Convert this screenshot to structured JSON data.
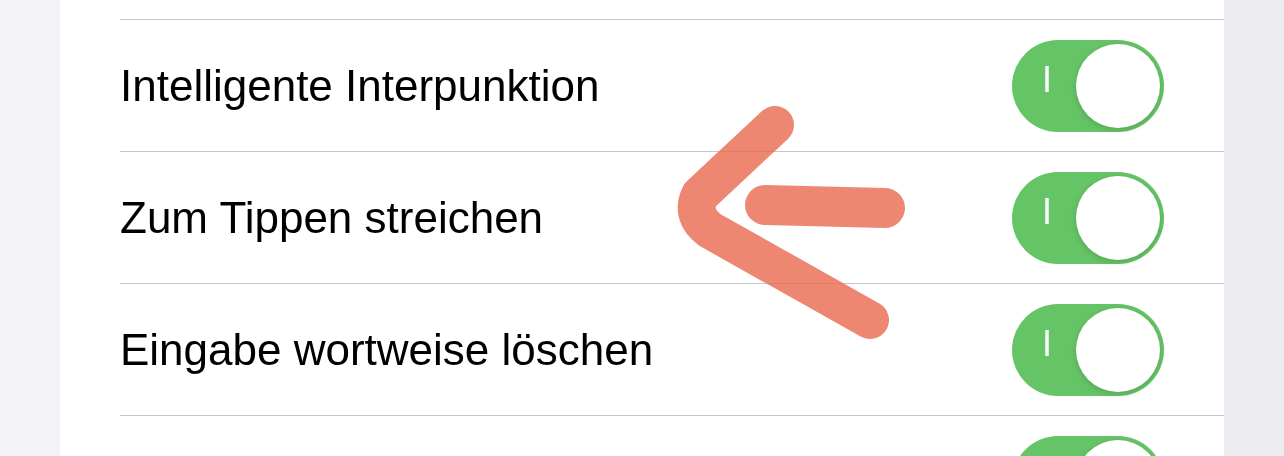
{
  "settings": [
    {
      "label": "Intelligente Interpunktion",
      "on": true,
      "on_label": "I"
    },
    {
      "label": "Zum Tippen streichen",
      "on": true,
      "on_label": "I"
    },
    {
      "label": "Eingabe wortweise löschen",
      "on": true,
      "on_label": "I"
    },
    {
      "on": true
    }
  ]
}
